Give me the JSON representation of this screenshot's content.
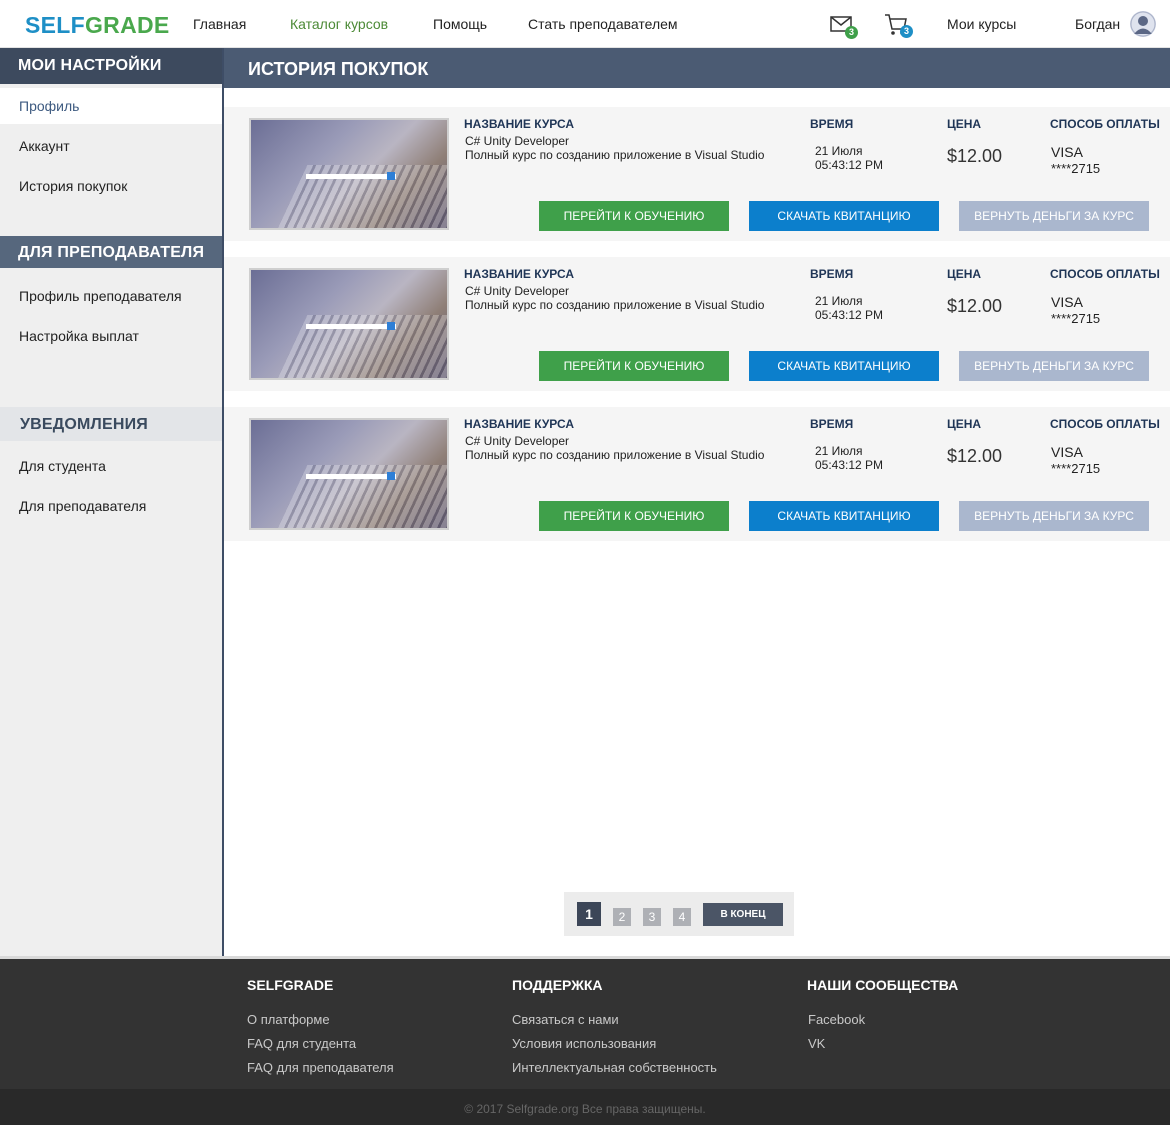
{
  "header": {
    "logo_part1": "SELF",
    "logo_part2": "GRADE",
    "nav": [
      "Главная",
      "Каталог курсов",
      "Помощь",
      "Стать преподавателем"
    ],
    "mail_count": "3",
    "cart_count": "3",
    "my_courses": "Мои курсы",
    "user_name": "Богдан"
  },
  "sidebar": {
    "section1_title": "Мои настройки",
    "section1_items": [
      "Профиль",
      "Аккаунт",
      "История покупок"
    ],
    "section2_title": "Для преподавателя",
    "section2_items": [
      "Профиль преподавателя",
      "Настройка выплат"
    ],
    "section3_title": "Уведомления",
    "section3_items": [
      "Для студента",
      "Для преподавателя"
    ]
  },
  "main": {
    "title": "История покупок",
    "headers": {
      "course": "Название курса",
      "time": "Время",
      "price": "Цена",
      "payment": "Способ оплаты"
    },
    "purchases": [
      {
        "course_name": "C# Unity Developer",
        "course_desc": "Полный курс по созданию приложение в  Visual Studio",
        "date": "21 Июля",
        "time": "05:43:12 PM",
        "price": "$12.00",
        "card_type": "VISA",
        "card_number": "****2715",
        "btn_go": "Перейти к обучению",
        "btn_receipt": "Скачать квитанцию",
        "btn_refund": "Вернуть деньги за курс"
      },
      {
        "course_name": "C# Unity Developer",
        "course_desc": "Полный курс по созданию приложение в  Visual Studio",
        "date": "21 Июля",
        "time": "05:43:12 PM",
        "price": "$12.00",
        "card_type": "VISA",
        "card_number": "****2715",
        "btn_go": "Перейти к обучению",
        "btn_receipt": "Скачать квитанцию",
        "btn_refund": "Вернуть деньги за курс"
      },
      {
        "course_name": "C# Unity Developer",
        "course_desc": "Полный курс по созданию приложение в  Visual Studio",
        "date": "21 Июля",
        "time": "05:43:12 PM",
        "price": "$12.00",
        "card_type": "VISA",
        "card_number": "****2715",
        "btn_go": "Перейти к обучению",
        "btn_receipt": "Скачать квитанцию",
        "btn_refund": "Вернуть деньги за курс"
      }
    ]
  },
  "pagination": {
    "current": "1",
    "pages": [
      "2",
      "3",
      "4"
    ],
    "end_label": "В конец"
  },
  "footer": {
    "col1_title": "SELFGRADE",
    "col1_links": [
      "О платформе",
      "FAQ для студента",
      "FAQ для преподавателя"
    ],
    "col2_title": "Поддержка",
    "col2_links": [
      "Связаться с нами",
      "Условия использования",
      "Интеллектуальная собственность"
    ],
    "col3_title": "Наши сообщества",
    "col3_links": [
      "Facebook",
      "VK"
    ],
    "copyright": "© 2017 Selfgrade.org Все права защищены."
  },
  "colors": {
    "accent_green": "#3fa04a",
    "accent_blue": "#0c7fcc",
    "refund_gray": "#aab7ce",
    "sidebar_dark": "#3d4a5e"
  },
  "icons": [
    "mail-icon",
    "cart-icon",
    "user-avatar-icon"
  ]
}
